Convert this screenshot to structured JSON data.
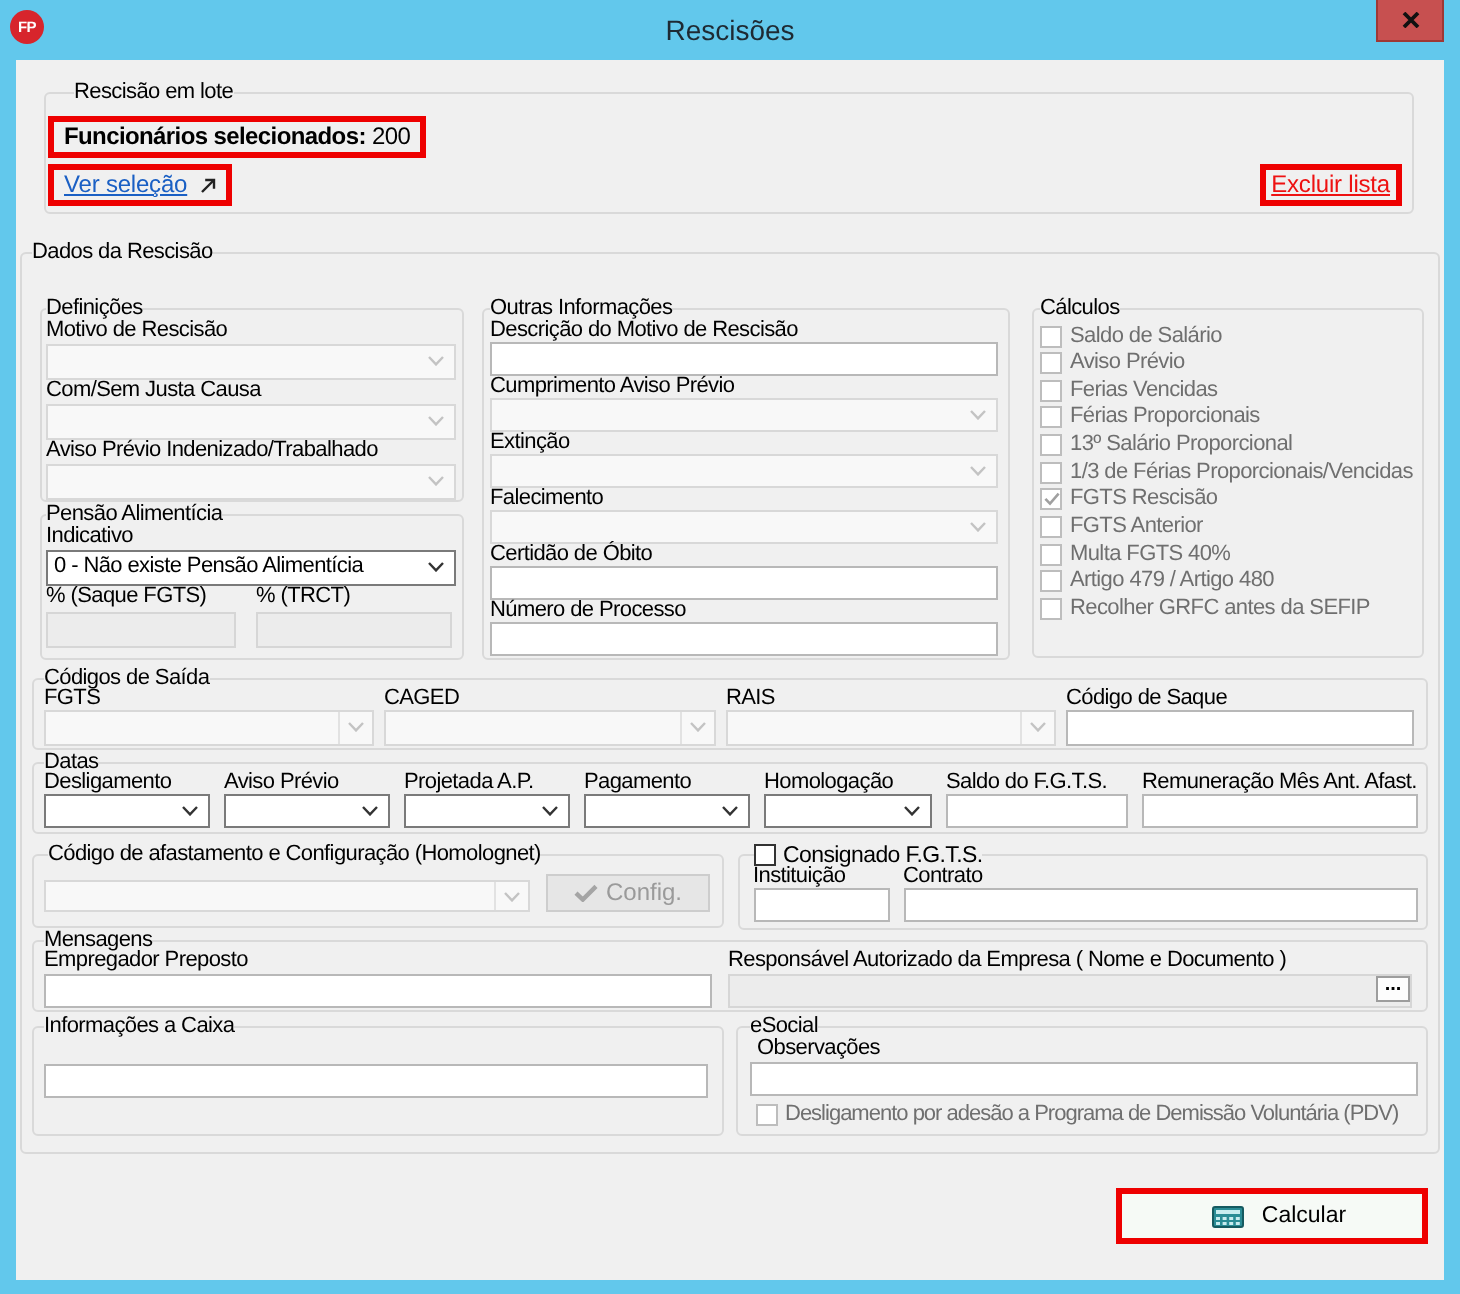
{
  "window": {
    "title": "Rescisões",
    "logo_text": "FP"
  },
  "lote": {
    "legend": "Rescisão em lote",
    "summary": {
      "text": "**Funcionários selecionados:** 200",
      "highlighted": true
    },
    "links": [
      {
        "kind": "view",
        "label": "Ver seleção",
        "highlighted": true
      },
      {
        "kind": "delete",
        "label": "Excluir lista",
        "highlighted": true
      }
    ]
  },
  "dados": {
    "legend": "Dados da Rescisão",
    "definicoes": {
      "legend": "Definições",
      "fields": [
        {
          "label": "Motivo de Rescisão",
          "kind": "select",
          "disabled": true
        },
        {
          "label": "Com/Sem Justa Causa",
          "kind": "select",
          "disabled": true
        },
        {
          "label": "Aviso Prévio Indenizado/Trabalhado",
          "kind": "select",
          "disabled": true
        }
      ]
    },
    "pensao": {
      "legend": "Pensão Alimentícia",
      "fields": [
        {
          "label": "Indicativo",
          "kind": "select",
          "value": "0 - Não existe Pensão Alimentícia",
          "disabled": false
        }
      ],
      "percent_fields": [
        {
          "label": "% (Saque FGTS)",
          "kind": "text",
          "disabled": true
        },
        {
          "label": "% (TRCT)",
          "kind": "text",
          "disabled": true
        }
      ]
    },
    "outras": {
      "legend": "Outras Informações",
      "fields": [
        {
          "label": "Descrição do Motivo de Rescisão",
          "kind": "text",
          "disabled": false
        },
        {
          "label": "Cumprimento Aviso Prévio",
          "kind": "select",
          "disabled": true
        },
        {
          "label": "Extinção",
          "kind": "select",
          "disabled": true
        },
        {
          "label": "Falecimento",
          "kind": "select",
          "disabled": true
        },
        {
          "label": "Certidão de Óbito",
          "kind": "text",
          "disabled": false
        },
        {
          "label": "Número de Processo",
          "kind": "text",
          "disabled": false
        }
      ]
    },
    "calculos": {
      "legend": "Cálculos",
      "items": [
        {
          "label": "Saldo de Salário",
          "checked": false,
          "disabled": true
        },
        {
          "label": "Aviso Prévio",
          "checked": false,
          "disabled": true
        },
        {
          "label": "Ferias Vencidas",
          "checked": false,
          "disabled": true
        },
        {
          "label": "Férias Proporcionais",
          "checked": false,
          "disabled": true
        },
        {
          "label": "13º Salário Proporcional",
          "checked": false,
          "disabled": true
        },
        {
          "label": "1/3 de Férias Proporcionais/Vencidas",
          "checked": false,
          "disabled": true
        },
        {
          "label": "FGTS Rescisão",
          "checked": true,
          "disabled": true
        },
        {
          "label": "FGTS Anterior",
          "checked": false,
          "disabled": true
        },
        {
          "label": "Multa FGTS 40%",
          "checked": false,
          "disabled": true
        },
        {
          "label": "Artigo 479 / Artigo 480",
          "checked": false,
          "disabled": true
        },
        {
          "label": "Recolher GRFC antes da SEFIP",
          "checked": false,
          "disabled": true
        }
      ]
    },
    "codigos_saida": {
      "legend": "Códigos de Saída",
      "fields": [
        {
          "label": "FGTS",
          "kind": "combo",
          "disabled": true
        },
        {
          "label": "CAGED",
          "kind": "combo",
          "disabled": true
        },
        {
          "label": "RAIS",
          "kind": "combo",
          "disabled": true
        },
        {
          "label": "Código de Saque",
          "kind": "text",
          "disabled": false
        }
      ]
    },
    "datas": {
      "legend": "Datas",
      "fields": [
        {
          "label": "Desligamento",
          "kind": "select",
          "disabled": false
        },
        {
          "label": "Aviso Prévio",
          "kind": "select",
          "disabled": false
        },
        {
          "label": "Projetada A.P.",
          "kind": "select",
          "disabled": false
        },
        {
          "label": "Pagamento",
          "kind": "select",
          "disabled": false
        },
        {
          "label": "Homologação",
          "kind": "select",
          "disabled": false
        },
        {
          "label": "Saldo do F.G.T.S.",
          "kind": "text",
          "disabled": false
        },
        {
          "label": "Remuneração Mês Ant. Afast.",
          "kind": "text",
          "disabled": false
        }
      ]
    },
    "afastamento": {
      "legend": "Código de afastamento e Configuração (Homolognet)",
      "field": {
        "kind": "combo",
        "disabled": true
      },
      "config_button": {
        "label": "Config.",
        "disabled": true
      }
    },
    "consignado": {
      "checkbox": {
        "label": "Consignado F.G.T.S.",
        "checked": false,
        "disabled": false
      },
      "fields": [
        {
          "label": "Instituição",
          "kind": "text",
          "disabled": false
        },
        {
          "label": "Contrato",
          "kind": "text",
          "disabled": false
        }
      ]
    },
    "mensagens": {
      "legend": "Mensagens",
      "fields": [
        {
          "label": "Empregador Preposto",
          "kind": "text",
          "disabled": false
        },
        {
          "label": "Responsável Autorizado da Empresa ( Nome e Documento )",
          "kind": "lookup",
          "disabled": true,
          "button_text": "..."
        }
      ]
    },
    "informacoes_caixa": {
      "legend": "Informações a Caixa",
      "field": {
        "kind": "text",
        "disabled": false
      }
    },
    "esocial": {
      "legend": "eSocial",
      "field": {
        "label": "Observações",
        "kind": "text",
        "disabled": false
      },
      "checkbox": {
        "label": "Desligamento por adesão a Programa de Demissão Voluntária (PDV)",
        "checked": false,
        "disabled": true
      }
    }
  },
  "calcular_button": {
    "label": "Calcular",
    "highlighted": true
  }
}
